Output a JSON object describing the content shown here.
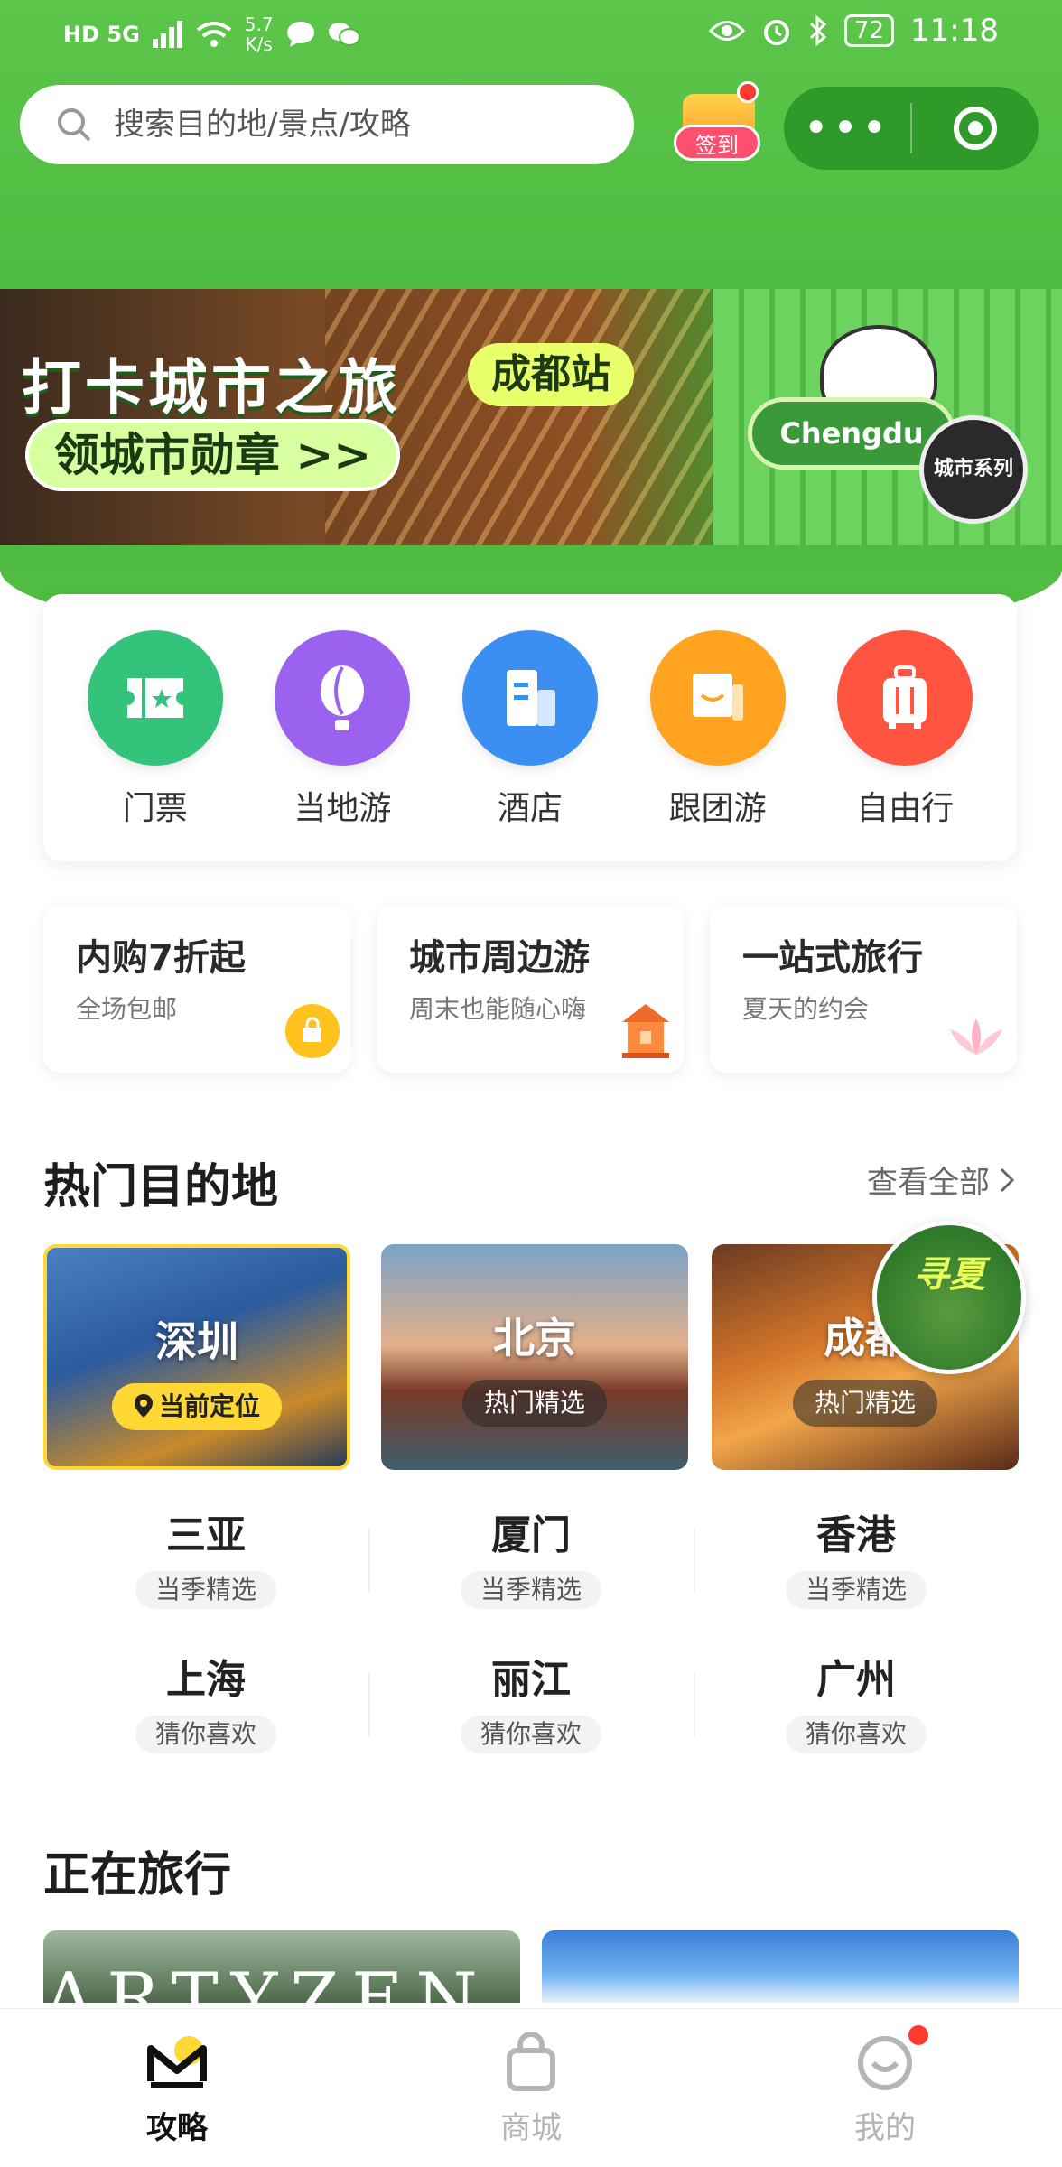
{
  "status_bar": {
    "left_indicators": "HD 5G",
    "net_speed": "5.7",
    "net_unit": "K/s",
    "battery": "72",
    "time": "11:18"
  },
  "search": {
    "placeholder": "搜索目的地/景点/攻略"
  },
  "signin": {
    "label": "签到"
  },
  "capsule": {
    "more": "•••"
  },
  "banner": {
    "title": "打卡城市之旅",
    "tag": "成都站",
    "cta": "领城市勋章 >>",
    "medal_text": "Chengdu",
    "seal_text": "城市系列"
  },
  "categories": [
    {
      "label": "门票",
      "color": "#33c37a",
      "icon": "ticket-icon"
    },
    {
      "label": "当地游",
      "color": "#9a62ee",
      "icon": "balloon-icon"
    },
    {
      "label": "酒店",
      "color": "#3c8ff2",
      "icon": "building-icon"
    },
    {
      "label": "跟团游",
      "color": "#ffa320",
      "icon": "flag-icon"
    },
    {
      "label": "自由行",
      "color": "#ff5540",
      "icon": "suitcase-icon"
    }
  ],
  "promos": [
    {
      "title": "内购7折起",
      "sub": "全场包邮",
      "icon": "bag-icon"
    },
    {
      "title": "城市周边游",
      "sub": "周末也能随心嗨",
      "icon": "pavilion-icon"
    },
    {
      "title": "一站式旅行",
      "sub": "夏天的约会",
      "icon": "lotus-icon"
    }
  ],
  "hot": {
    "title": "热门目的地",
    "see_all": "查看全部"
  },
  "dest_cards": [
    {
      "city": "深圳",
      "tag": "当前定位",
      "icon": "location-pin-icon"
    },
    {
      "city": "北京",
      "tag": "热门精选"
    },
    {
      "city": "成都",
      "tag": "热门精选"
    }
  ],
  "float_badge": {
    "text": "寻夏"
  },
  "dest_grid": [
    [
      {
        "name": "三亚",
        "sub": "当季精选"
      },
      {
        "name": "厦门",
        "sub": "当季精选"
      },
      {
        "name": "香港",
        "sub": "当季精选"
      }
    ],
    [
      {
        "name": "上海",
        "sub": "猜你喜欢"
      },
      {
        "name": "丽江",
        "sub": "猜你喜欢"
      },
      {
        "name": "广州",
        "sub": "猜你喜欢"
      }
    ]
  ],
  "traveling": {
    "title": "正在旅行",
    "card1_text": "ARTYZEN"
  },
  "tabs": [
    {
      "label": "攻略",
      "icon": "guide-m-icon",
      "active": true
    },
    {
      "label": "商城",
      "icon": "shopping-bag-icon",
      "active": false
    },
    {
      "label": "我的",
      "icon": "smile-icon",
      "active": false
    }
  ]
}
